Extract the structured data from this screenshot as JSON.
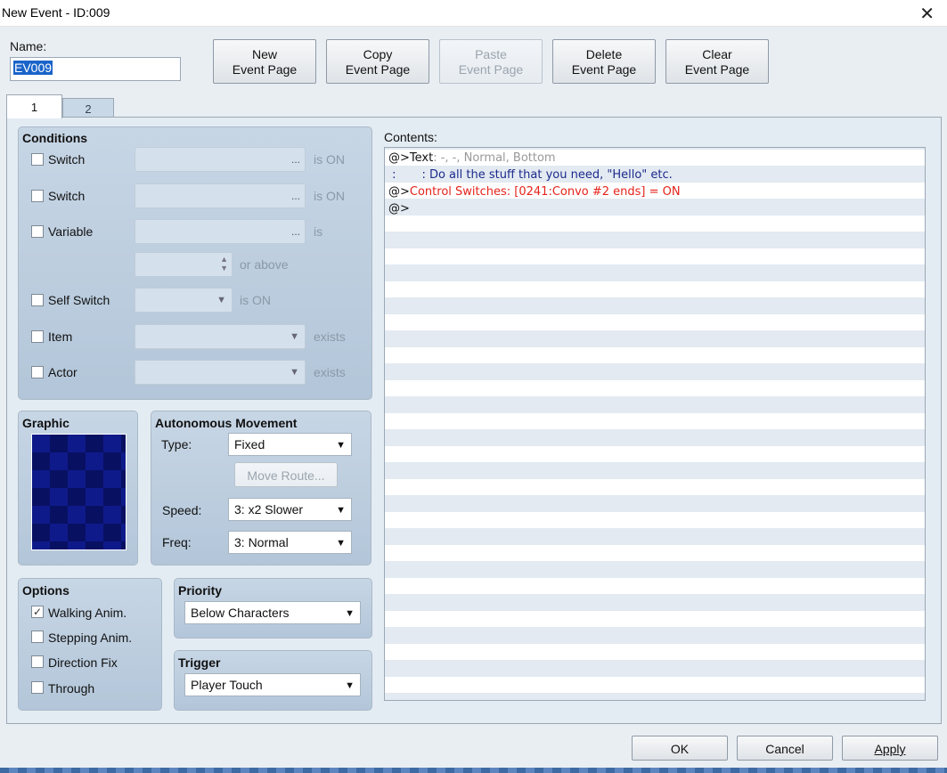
{
  "window": {
    "title": "New Event - ID:009",
    "close_glyph": "✕"
  },
  "name": {
    "label": "Name:",
    "value": "EV009"
  },
  "toolbar": {
    "new_page_line1": "New",
    "new_page_line2": "Event Page",
    "copy_page_line1": "Copy",
    "copy_page_line2": "Event Page",
    "paste_page_line1": "Paste",
    "paste_page_line2": "Event Page",
    "delete_page_line1": "Delete",
    "delete_page_line2": "Event Page",
    "clear_page_line1": "Clear",
    "clear_page_line2": "Event Page"
  },
  "tabs": [
    {
      "label": "1",
      "active": true
    },
    {
      "label": "2",
      "active": false
    }
  ],
  "conditions": {
    "title": "Conditions",
    "switch1_label": "Switch",
    "switch1_suffix": "is ON",
    "switch2_label": "Switch",
    "switch2_suffix": "is ON",
    "variable_label": "Variable",
    "variable_suffix": "is",
    "or_above": "or above",
    "self_switch_label": "Self Switch",
    "self_switch_suffix": "is ON",
    "item_label": "Item",
    "item_suffix": "exists",
    "actor_label": "Actor",
    "actor_suffix": "exists",
    "ellipsis": "..."
  },
  "graphic": {
    "title": "Graphic"
  },
  "movement": {
    "title": "Autonomous Movement",
    "type_label": "Type:",
    "type_value": "Fixed",
    "move_route_button": "Move Route...",
    "speed_label": "Speed:",
    "speed_value": "3: x2 Slower",
    "freq_label": "Freq:",
    "freq_value": "3: Normal"
  },
  "options": {
    "title": "Options",
    "walking": {
      "label": "Walking Anim.",
      "checked": true,
      "mark": "✓"
    },
    "stepping": {
      "label": "Stepping Anim.",
      "checked": false
    },
    "direction_fix": {
      "label": "Direction Fix",
      "checked": false
    },
    "through": {
      "label": "Through",
      "checked": false
    }
  },
  "priority": {
    "title": "Priority",
    "value": "Below Characters"
  },
  "trigger": {
    "title": "Trigger",
    "value": "Player Touch"
  },
  "contents": {
    "label": "Contents:",
    "line1_prefix": "@>Text",
    "line1_rest": ": -, -, Normal, Bottom",
    "line2": " :       : Do all the stuff that you need, \"Hello\" etc.",
    "line3_prefix": "@>",
    "line3_rest": "Control Switches: [0241:Convo #2 ends] = ON",
    "line4": "@>"
  },
  "footer": {
    "ok": "OK",
    "cancel": "Cancel",
    "apply": "Apply"
  },
  "glyphs": {
    "dropdown": "▼",
    "spin_up": "▲",
    "spin_down": "▼"
  }
}
